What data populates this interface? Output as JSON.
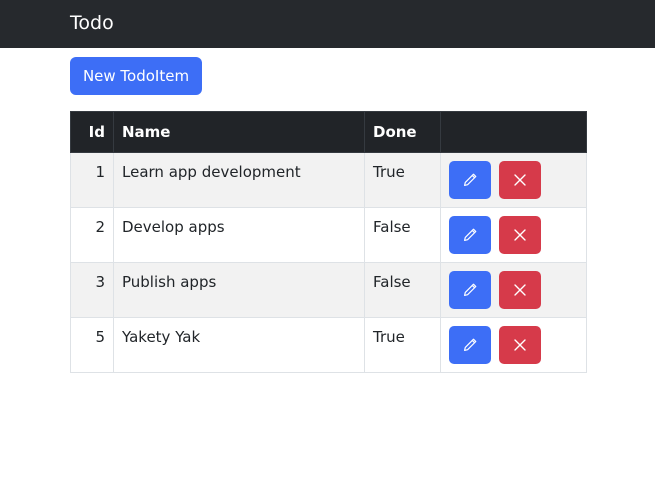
{
  "navbar": {
    "brand": "Todo"
  },
  "toolbar": {
    "new_label": "New TodoItem"
  },
  "table": {
    "headers": {
      "id": "Id",
      "name": "Name",
      "done": "Done",
      "actions": ""
    },
    "rows": [
      {
        "id": "1",
        "name": "Learn app development",
        "done": "True"
      },
      {
        "id": "2",
        "name": "Develop apps",
        "done": "False"
      },
      {
        "id": "3",
        "name": "Publish apps",
        "done": "False"
      },
      {
        "id": "5",
        "name": "Yakety Yak",
        "done": "True"
      }
    ]
  },
  "icons": {
    "edit": "pencil-icon",
    "delete": "x-icon"
  },
  "colors": {
    "navbar": "#26292d",
    "primary": "#3d6ef6",
    "danger": "#d63a4a",
    "table_header": "#212428",
    "stripe": "#f2f2f2"
  }
}
